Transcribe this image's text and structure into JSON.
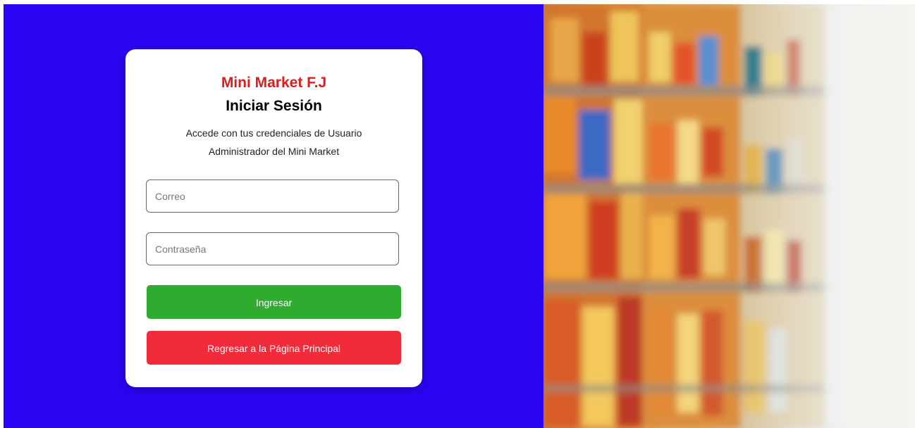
{
  "login_card": {
    "brand": "Mini Market F.J",
    "title": "Iniciar Sesión",
    "subtitle": "Accede con tus credenciales de Usuario Administrador del Mini Market",
    "email_placeholder": "Correo",
    "email_value": "",
    "password_placeholder": "Contraseña",
    "password_value": "",
    "login_label": "Ingresar",
    "back_label": "Regresar a la Página Principal"
  },
  "colors": {
    "left_background": "#2a05f2",
    "brand_text": "#e01b1b",
    "login_button": "#2fab2f",
    "back_button": "#f12b3a"
  },
  "side_image": {
    "icon": "supermarket-shelves-photo"
  }
}
